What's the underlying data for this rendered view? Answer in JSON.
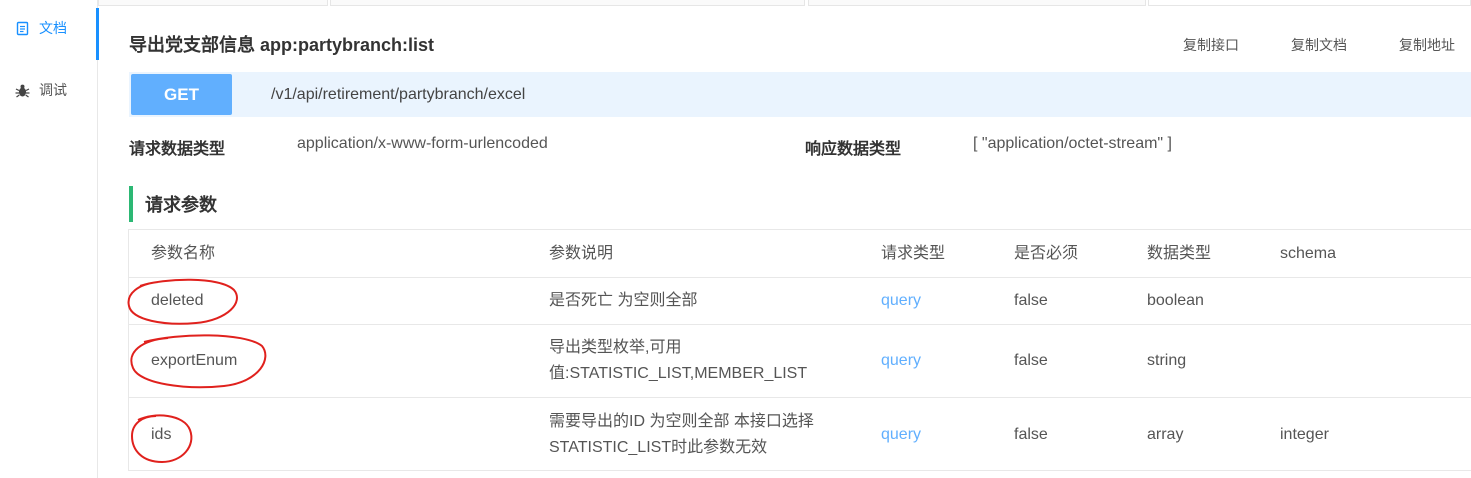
{
  "sidebar": {
    "items": [
      {
        "label": "文档",
        "icon": "document-icon",
        "active": true
      },
      {
        "label": "调试",
        "icon": "bug-icon",
        "active": false
      }
    ]
  },
  "header": {
    "title": "导出党支部信息 app:partybranch:list",
    "actions": [
      "复制接口",
      "复制文档",
      "复制地址"
    ]
  },
  "request": {
    "method": "GET",
    "path": "/v1/api/retirement/partybranch/excel",
    "request_type_label": "请求数据类型",
    "request_type_value": "application/x-www-form-urlencoded",
    "response_type_label": "响应数据类型",
    "response_type_value": "[ \"application/octet-stream\" ]"
  },
  "params": {
    "section_title": "请求参数",
    "headers": [
      "参数名称",
      "参数说明",
      "请求类型",
      "是否必须",
      "数据类型",
      "schema"
    ],
    "rows": [
      {
        "name": "deleted",
        "desc": [
          "是否死亡 为空则全部"
        ],
        "in": "query",
        "required": "false",
        "type": "boolean",
        "schema": ""
      },
      {
        "name": "exportEnum",
        "desc": [
          "导出类型枚举,可用",
          "值:STATISTIC_LIST,MEMBER_LIST"
        ],
        "in": "query",
        "required": "false",
        "type": "string",
        "schema": ""
      },
      {
        "name": "ids",
        "desc": [
          "需要导出的ID 为空则全部 本接口选择",
          "STATISTIC_LIST时此参数无效"
        ],
        "in": "query",
        "required": "false",
        "type": "array",
        "schema": "integer"
      }
    ]
  },
  "colors": {
    "accent": "#1890ff",
    "get_method": "#61affe",
    "url_bg": "#eaf4fe",
    "section_bar": "#2cb874",
    "annotation": "#e0211d"
  }
}
